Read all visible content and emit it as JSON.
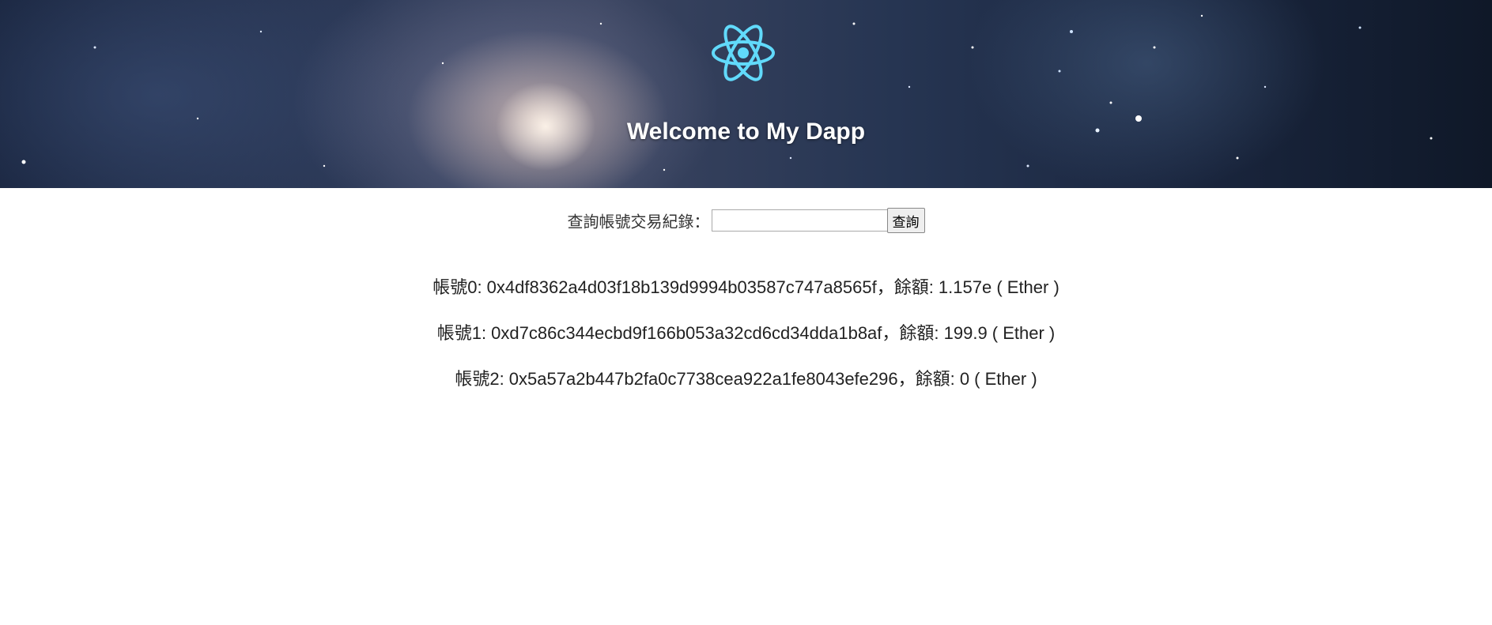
{
  "header": {
    "title": "Welcome to My Dapp",
    "logo_icon": "react-atom-icon",
    "logo_color": "#61dafb"
  },
  "search": {
    "label": "查詢帳號交易紀錄：",
    "input_value": "",
    "button_label": "查詢"
  },
  "accounts": [
    {
      "text": "帳號0: 0x4df8362a4d03f18b139d9994b03587c747a8565f，餘額: 1.157e ( Ether )"
    },
    {
      "text": "帳號1: 0xd7c86c344ecbd9f166b053a32cd6cd34dda1b8af，餘額: 199.9 ( Ether )"
    },
    {
      "text": "帳號2: 0x5a57a2b447b2fa0c7738cea922a1fe8043efe296，餘額: 0 ( Ether )"
    }
  ]
}
